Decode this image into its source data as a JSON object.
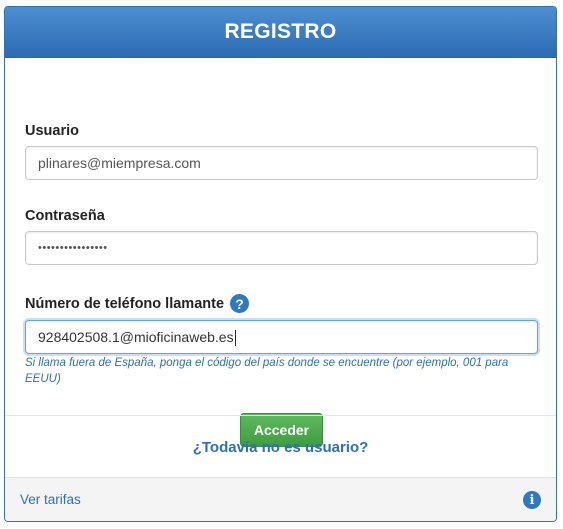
{
  "header": {
    "title": "REGISTRO"
  },
  "form": {
    "user_label": "Usuario",
    "user_value": "plinares@miempresa.com",
    "password_label": "Contraseña",
    "password_value": "••••••••••••••••",
    "phone_label": "Número de teléfono llamante",
    "help_icon": "question-circle-icon",
    "help_glyph": "?",
    "phone_value": "928402508.1@mioficinaweb.es",
    "phone_hint": "Si llama fuera de España, ponga el código del país donde se encuentre (por ejemplo, 001 para EEUU)",
    "submit_label": "Acceder"
  },
  "signup": {
    "label": "¿Todavía no es usuario?"
  },
  "footer": {
    "link_label": "Ver tarifas",
    "info_icon": "info-circle-icon",
    "info_glyph": "i"
  },
  "colors": {
    "header_blue": "#2d6bb2",
    "link_blue": "#2f6fb7",
    "button_green": "#4cae4c"
  }
}
